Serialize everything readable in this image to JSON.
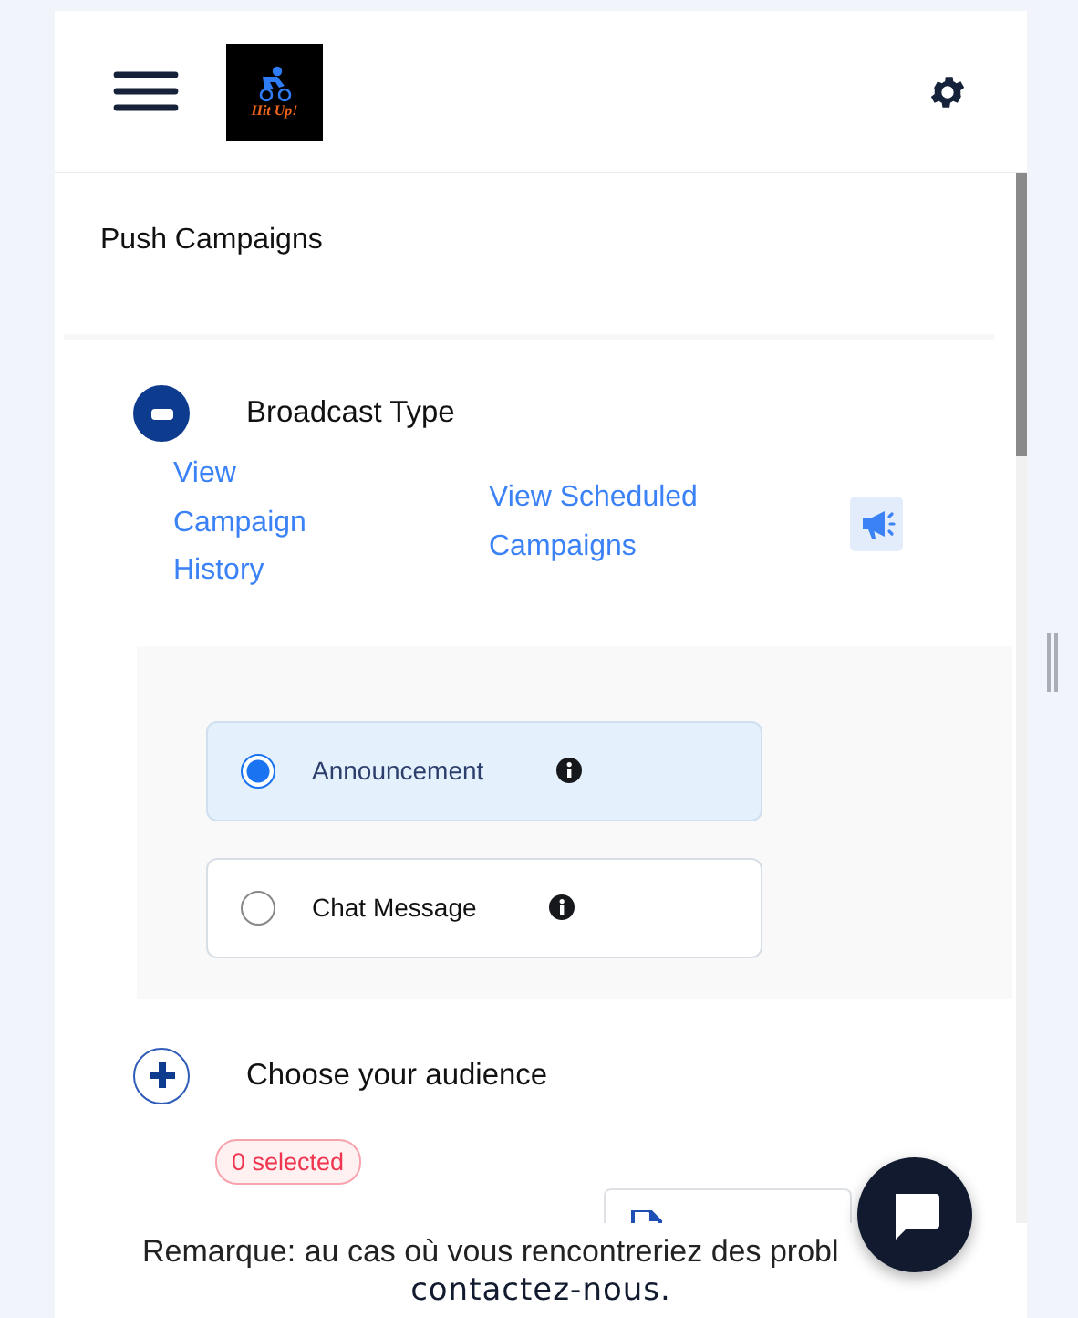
{
  "header": {
    "logo_text": "Hit Up!"
  },
  "page_title": "Push Campaigns",
  "sections": [
    {
      "title": "Broadcast Type",
      "expanded": true,
      "links": [
        "View Campaign History",
        "View Scheduled Campaigns"
      ],
      "options": [
        {
          "label": "Announcement",
          "selected": true
        },
        {
          "label": "Chat Message",
          "selected": false
        }
      ]
    },
    {
      "title": "Choose your audience",
      "expanded": false,
      "badge": "0 selected",
      "has_upload_button": true
    }
  ],
  "notice": {
    "text": "Remarque: au cas où vous rencontreriez des probl",
    "link": "contactez-nous."
  }
}
